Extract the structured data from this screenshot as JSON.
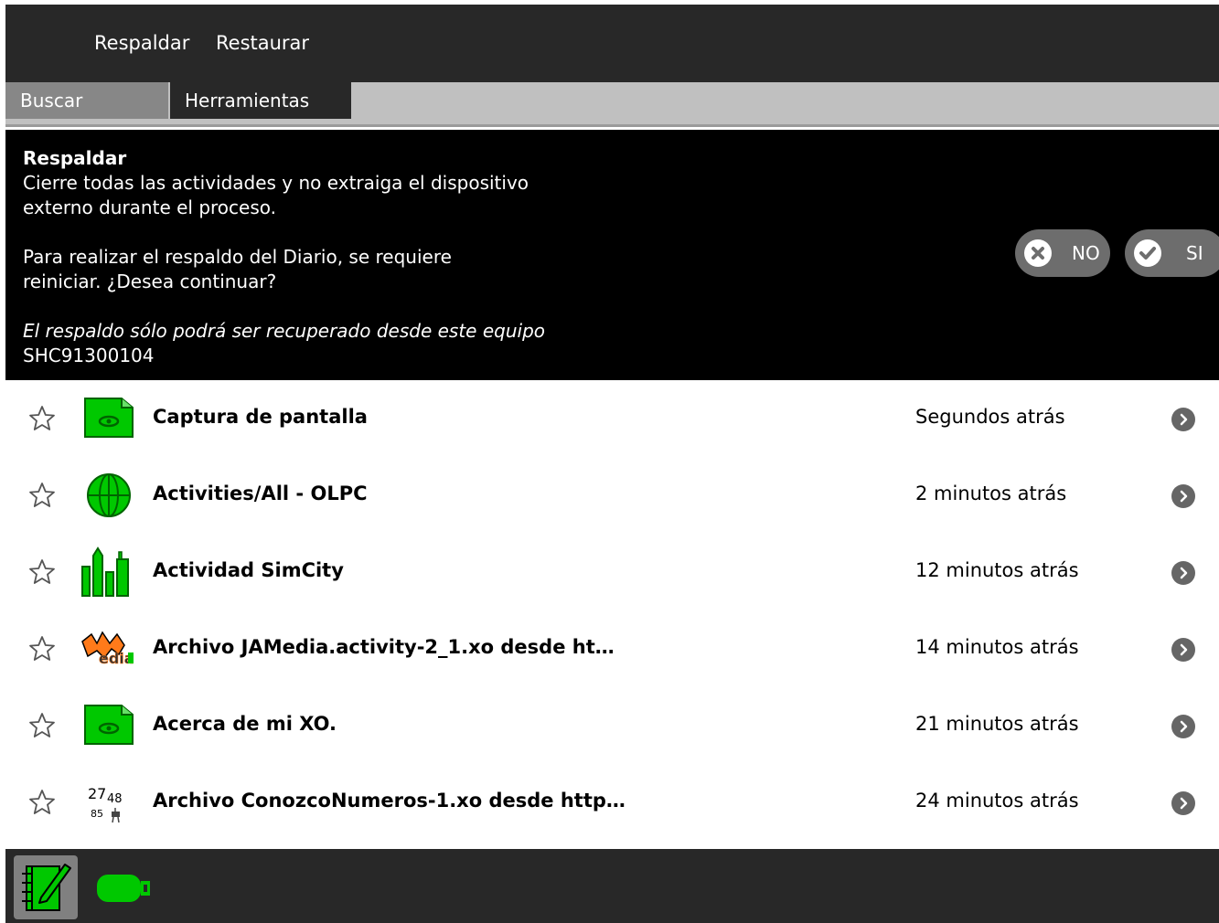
{
  "toolbar": {
    "menu": [
      "Respaldar",
      "Restaurar"
    ]
  },
  "tabs": {
    "buscar": "Buscar",
    "herramientas": "Herramientas"
  },
  "alert": {
    "title": "Respaldar",
    "message": "Cierre todas las actividades y no extraiga el dispositivo\nexterno durante el proceso.",
    "message2": "Para realizar el respaldo del Diario, se requiere\nreiniciar. ¿Desea continuar?",
    "note": "El respaldo sólo podrá ser recuperado desde este equipo",
    "serial": "SHC91300104",
    "no_label": "NO",
    "yes_label": "SI"
  },
  "entries": [
    {
      "title": "Captura de pantalla",
      "time": "Segundos atrás",
      "icon": "image-viewer-icon"
    },
    {
      "title": "Activities/All - OLPC",
      "time": "2 minutos atrás",
      "icon": "browse-globe-icon"
    },
    {
      "title": "Actividad SimCity",
      "time": "12 minutos atrás",
      "icon": "simcity-icon"
    },
    {
      "title": "Archivo JAMedia.activity-2_1.xo desde ht…",
      "time": "14 minutos atrás",
      "icon": "jamedia-icon",
      "icon_text": "edia"
    },
    {
      "title": "Acerca de mi XO.",
      "time": "21 minutos atrás",
      "icon": "image-viewer-icon"
    },
    {
      "title": "Archivo ConozcoNumeros-1.xo desde http…",
      "time": "24 minutos atrás",
      "icon": "conozco-numeros-icon",
      "icon_text": [
        "27",
        "48",
        "85"
      ]
    }
  ],
  "bottombar": {
    "icons": [
      "journal-icon",
      "usb-drive-icon"
    ]
  },
  "colors": {
    "toolbar_bg": "#282828",
    "accent_green": "#00c800",
    "alert_bg": "#000000",
    "pill_bg": "#6d6d6d"
  }
}
